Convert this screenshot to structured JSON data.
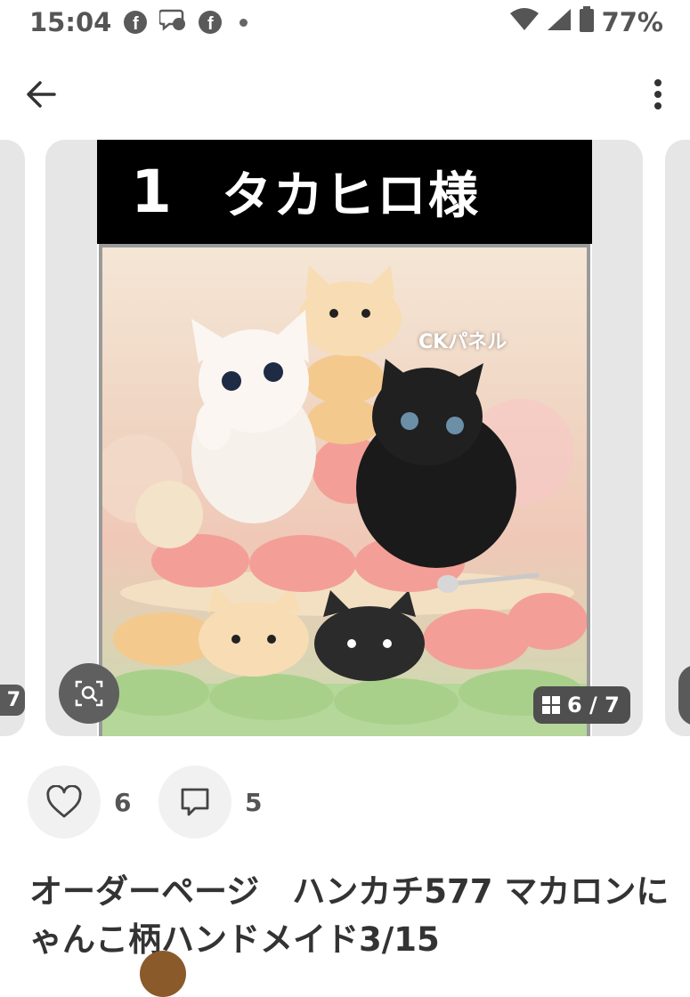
{
  "status_bar": {
    "time": "15:04",
    "battery": "77%",
    "fb_glyph": "f",
    "icons": [
      "facebook-icon",
      "messenger-icon",
      "facebook-icon",
      "dot",
      "wifi-icon",
      "signal-icon",
      "battery-icon"
    ]
  },
  "appbar": {
    "back_icon": "arrow-left-icon",
    "more_icon": "more-vertical-icon"
  },
  "carousel": {
    "left_peek_label": "7",
    "banner_number": "1",
    "banner_name": "タカヒロ様",
    "watermark": "CKパネル",
    "counter": "6 / 7"
  },
  "actions": {
    "like_count": "6",
    "comment_count": "5"
  },
  "product": {
    "title": "オーダーページ　ハンカチ577 マカロンにゃんこ柄ハンドメイド3/15"
  },
  "colors": {
    "card_bg": "#e6e6e6",
    "badge_bg": "#4f4f4f",
    "action_bg": "#f1f1f1"
  }
}
